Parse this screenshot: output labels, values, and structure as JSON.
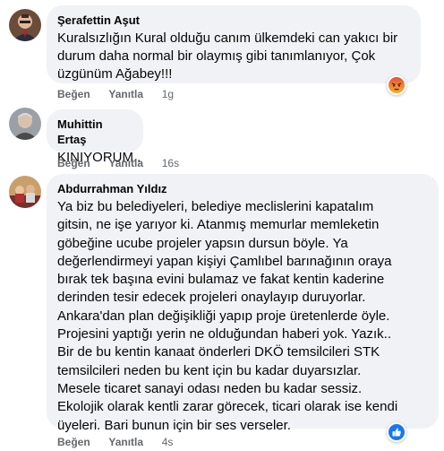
{
  "comments": [
    {
      "author": "Şerafettin Aşut",
      "text": "Kuralsızlığın Kural olduğu canım ülkemdeki can yakıcı bir\ndurum daha normal bir olaymış gibi tanımlanıyor, Çok\nüzgünüm Ağabey!!!",
      "like": "Beğen",
      "reply": "Yanıtla",
      "time": "1g",
      "reaction_icon": "angry-icon"
    },
    {
      "author": "Muhittin Ertaş",
      "text": "KINIYORUM..",
      "like": "Beğen",
      "reply": "Yanıtla",
      "time": "16s"
    },
    {
      "author": "Abdurrahman Yıldız",
      "text": "Ya biz bu belediyeleri, belediye meclislerini kapatalım\ngitsin, ne işe yarıyor ki. Atanmış memurlar memleketin\ngöbeğine ucube projeler yapsın dursun böyle. Ya\ndeğerlendirmeyi yapan kişiyi Çamlıbel barınağının oraya\nbırak tek başına evini bulamaz ve fakat kentin kaderine\nderinden tesir edecek projeleri onaylayıp duruyorlar.\nAnkara'dan plan değişikliği yapıp proje üretenlerde öyle.\nProjesini yaptığı yerin ne olduğundan haberi yok. Yazık..\nBir de bu kentin kanaat önderleri DKÖ temsilcileri STK\ntemsilcileri neden bu kent için bu kadar duyarsızlar.\nMesele ticaret sanayi odası neden bu kadar sessiz.\nEkolojik olarak kentli zarar görecek, ticari olarak ise kendi\nüyeleri. Bari bunun için bir ses verseler.",
      "like": "Beğen",
      "reply": "Yanıtla",
      "time": "4s",
      "reaction_icon": "like-icon"
    }
  ],
  "colors": {
    "bubble": "#f0f2f5",
    "meta": "#65676b",
    "like_blue": "#1877f2",
    "angry_top": "#e8503a",
    "angry_bottom": "#f7b125"
  }
}
